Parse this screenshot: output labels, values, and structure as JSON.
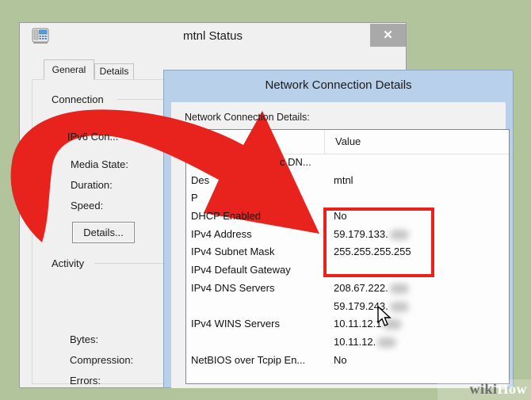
{
  "background_color": "#b2c49b",
  "status_dialog": {
    "title": "mtnl Status",
    "icons": {
      "app": "phone-connection-icon",
      "close": "✕"
    },
    "tabs": [
      {
        "label": "General",
        "active": true
      },
      {
        "label": "Details",
        "active": false
      }
    ],
    "connection_group": {
      "label": "Connection",
      "rows": [
        "IPv6 Con...",
        "Media State:",
        "Duration:",
        "Speed:"
      ],
      "details_button": "Details..."
    },
    "activity_group": {
      "label": "Activity",
      "rows": [
        "Bytes:",
        "Compression:",
        "Errors:"
      ]
    }
  },
  "details_dialog": {
    "title": "Network Connection Details",
    "label": "Network Connection Details:",
    "value_column_header": "Value",
    "rows": [
      {
        "property": "c DN...",
        "value": "",
        "indent": true,
        "blurred": false
      },
      {
        "property": "Des",
        "value": "mtnl",
        "indent": false,
        "blurred": false
      },
      {
        "property": "P",
        "value": "",
        "indent": false,
        "blurred": false
      },
      {
        "property": "DHCP Enabled",
        "value": "No",
        "indent": false,
        "blurred": false
      },
      {
        "property": "IPv4 Address",
        "value": "59.179.133.",
        "indent": false,
        "blurred": true
      },
      {
        "property": "IPv4 Subnet Mask",
        "value": "255.255.255.255",
        "indent": false,
        "blurred": false
      },
      {
        "property": "IPv4 Default Gateway",
        "value": "",
        "indent": false,
        "blurred": false
      },
      {
        "property": "IPv4 DNS Servers",
        "value": "208.67.222.",
        "indent": false,
        "blurred": true
      },
      {
        "property": "",
        "value": "59.179.243.",
        "indent": false,
        "blurred": true
      },
      {
        "property": "IPv4 WINS Servers",
        "value": "10.11.12.1",
        "indent": false,
        "blurred": true
      },
      {
        "property": "",
        "value": "10.11.12.",
        "indent": false,
        "blurred": true
      },
      {
        "property": "NetBIOS over Tcpip En...",
        "value": "No",
        "indent": false,
        "blurred": false
      }
    ]
  },
  "annotations": {
    "arrow_color": "#e8231d",
    "highlight_box_color": "#e8231d"
  },
  "watermark": {
    "wiki": "wiki",
    "how": "How"
  }
}
